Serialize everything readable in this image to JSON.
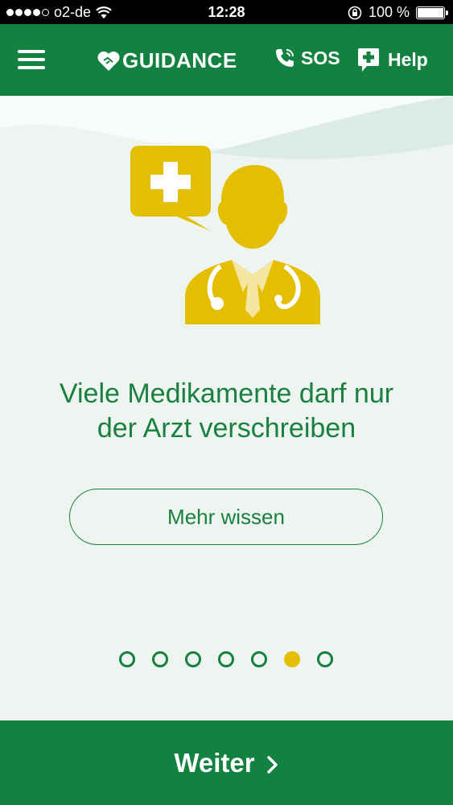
{
  "status_bar": {
    "carrier": "o2-de",
    "time": "12:28",
    "battery_percent_label": "100 %",
    "battery_level": 1.0
  },
  "navbar": {
    "menu_icon": "hamburger-icon",
    "brand": "GUIDANCE",
    "brand_icon": "heart-handshake-icon",
    "sos_label": "SOS",
    "sos_icon": "phone-icon",
    "help_label": "Help",
    "help_icon": "chat-plus-icon"
  },
  "slide": {
    "illustration": "doctor-with-medical-chat-bubble",
    "headline_line1": "Viele Medikamente darf nur",
    "headline_line2": "der Arzt verschreiben",
    "more_button": "Mehr wissen"
  },
  "pager": {
    "total": 7,
    "active_index": 5
  },
  "footer": {
    "next_label": "Weiter",
    "next_icon": "chevron-right-icon"
  },
  "colors": {
    "primary_green": "#13813f",
    "accent_yellow": "#e4be00",
    "background": "#eef5f1"
  }
}
